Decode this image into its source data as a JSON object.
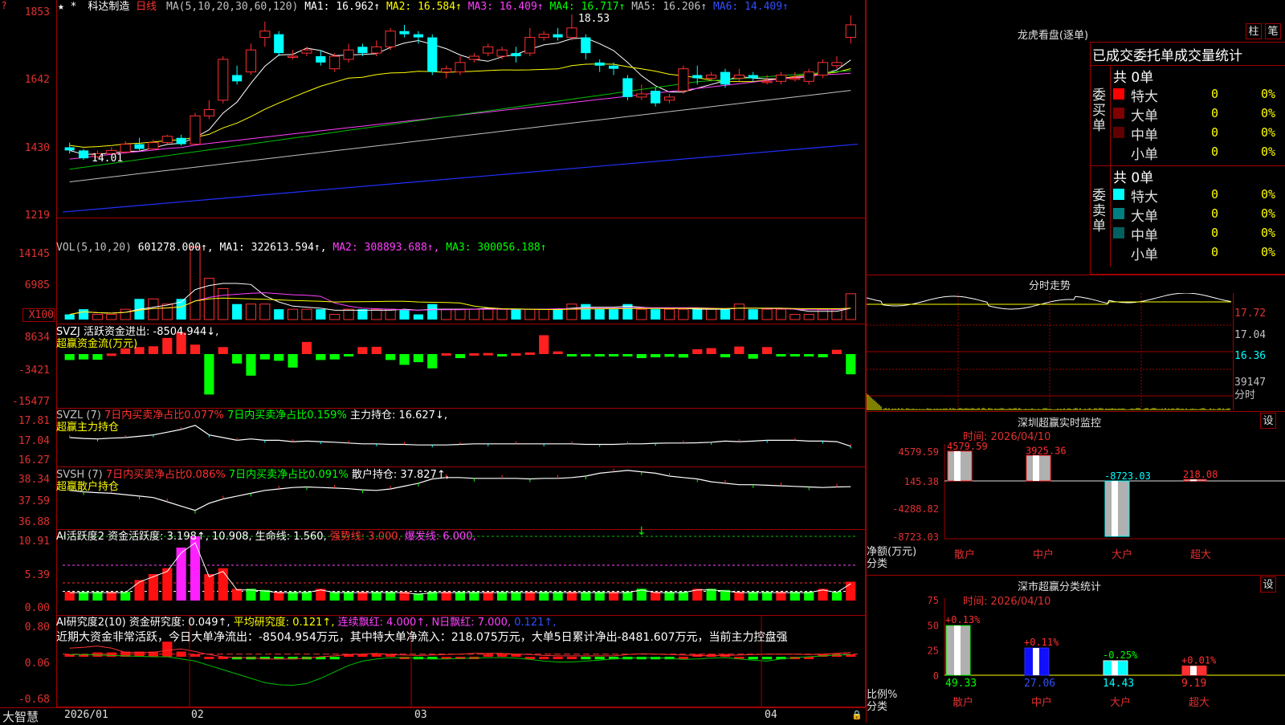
{
  "top_icon": "?",
  "stock": {
    "stars": "★ *",
    "name": "科达制造",
    "period": "日线",
    "ma_label": "MA(5,10,20,30,60,120)",
    "ma": [
      {
        "text": "MA1: 16.962↑",
        "color": "#ffffff"
      },
      {
        "text": "MA2: 16.584↑",
        "color": "#ffff00"
      },
      {
        "text": "MA3: 16.409↑",
        "color": "#ff40ff"
      },
      {
        "text": "MA4: 16.717↑",
        "color": "#00ff00"
      },
      {
        "text": "MA5: 16.206↑",
        "color": "#c0c0c0"
      },
      {
        "text": "MA6: 14.409↑",
        "color": "#3050ff"
      }
    ],
    "high_mark": "18.53",
    "low_mark": "14.01"
  },
  "axes": {
    "price": [
      "1853",
      "1642",
      "1430",
      "1219"
    ],
    "vol": [
      "14145",
      "6985",
      "X100"
    ],
    "svzj": [
      "8634",
      "-3421",
      "-15477"
    ],
    "svzl": [
      "17.81",
      "17.04",
      "16.27"
    ],
    "svsh": [
      "38.34",
      "37.59",
      "36.88"
    ],
    "ai1": [
      "10.91",
      "5.39",
      "0.00"
    ],
    "ai2": [
      "0.80",
      "0.06",
      "-0.68"
    ]
  },
  "vol_title": [
    {
      "text": "VOL(5,10,20)",
      "color": "#c0c0c0"
    },
    {
      "text": "601278.000↑,",
      "color": "#ffffff"
    },
    {
      "text": "MA1: 322613.594↑,",
      "color": "#ffffff"
    },
    {
      "text": "MA2: 308893.688↑,",
      "color": "#ff40ff"
    },
    {
      "text": "MA3: 300056.188↑",
      "color": "#00ff00"
    }
  ],
  "svzj_title": {
    "line1": "SVZJ  活跃资金进出: -8504.944↓,",
    "line2": "超赢资金流(万元)"
  },
  "svzl_title": {
    "prefix": "SVZL (7)",
    "a": "7日内买卖净占比0.077%",
    "b": "7日内买卖净占比0.159%",
    "c": "主力持仓: 16.627↓,",
    "line2": "超赢主力持仓"
  },
  "svsh_title": {
    "prefix": "SVSH (7)",
    "a": "7日内买卖净占比0.086%",
    "b": "7日内买卖净占比0.091%",
    "c": "散户持仓: 37.827↑,",
    "line2": "超赢散户持仓"
  },
  "ai1_title": [
    {
      "text": "AI活跃度2 资金活跃度: 3.198↑,",
      "color": "#ffffff"
    },
    {
      "text": "10.908,",
      "color": "#ffffff"
    },
    {
      "text": "生命线: 1.560,",
      "color": "#ffffff"
    },
    {
      "text": "强势线: 3.000,",
      "color": "#ff3030"
    },
    {
      "text": "爆发线: 6.000,",
      "color": "#ff40ff"
    }
  ],
  "ai2_title": [
    {
      "text": "AI研究度2(10) 资金研究度: 0.049↑,",
      "color": "#ffffff"
    },
    {
      "text": "平均研究度: 0.121↑,",
      "color": "#ffff00"
    },
    {
      "text": "连续飘红: 4.000↑,",
      "color": "#ff40ff"
    },
    {
      "text": "N日飘红: 7.000,",
      "color": "#ff40ff"
    },
    {
      "text": "0.121↑,",
      "color": "#3050ff"
    }
  ],
  "ai2_note": "近期大资金非常活跃，今日大单净流出：-8504.954万元，其中特大单净流入：218.075万元，大单5日累计净出-8481.607万元，当前主力控盘强",
  "bottom": {
    "brand": "大智慧",
    "dates": [
      "2026/01",
      "02",
      "03",
      "04"
    ]
  },
  "right": {
    "lhb_title": "龙虎看盘(逐单)",
    "btn_zhu": "柱",
    "btn_bi": "笔",
    "lhb_header": "已成交委托单成交量统计",
    "buy": {
      "side": "委买单",
      "total": "共 0单",
      "rows": [
        {
          "name": "特大",
          "v": "0",
          "p": "0%",
          "c": "#ff0000"
        },
        {
          "name": "大单",
          "v": "0",
          "p": "0%",
          "c": "#800000"
        },
        {
          "name": "中单",
          "v": "0",
          "p": "0%",
          "c": "#600000"
        },
        {
          "name": "小单",
          "v": "0",
          "p": "0%",
          "c": "#000000"
        }
      ]
    },
    "sell": {
      "side": "委卖单",
      "total": "共 0单",
      "rows": [
        {
          "name": "特大",
          "v": "0",
          "p": "0%",
          "c": "#00ffff"
        },
        {
          "name": "大单",
          "v": "0",
          "p": "0%",
          "c": "#008080"
        },
        {
          "name": "中单",
          "v": "0",
          "p": "0%",
          "c": "#006060"
        },
        {
          "name": "小单",
          "v": "0",
          "p": "0%",
          "c": "#000000"
        }
      ]
    },
    "fs_title": "分时走势",
    "fs_axis": [
      "17.72",
      "17.04",
      "16.36",
      "39147",
      "分时"
    ],
    "mon_title": "深圳超赢实时监控",
    "mon_set": "设",
    "mon_time": "时间: 2026/04/10",
    "mon_axis": [
      "4579.59",
      "145.38",
      "-4288.82",
      "-8723.03"
    ],
    "mon_ylabel": [
      "净额(万元)",
      "分类"
    ],
    "mon_bars": [
      {
        "cat": "散户",
        "value": 4579.59,
        "label": "4579.59"
      },
      {
        "cat": "中户",
        "value": 3925.36,
        "label": "3925.36"
      },
      {
        "cat": "大户",
        "value": -8723.03,
        "label": "-8723.03"
      },
      {
        "cat": "超大",
        "value": 218.08,
        "label": "218.08"
      }
    ],
    "cls_title": "深市超赢分类统计",
    "cls_set": "设",
    "cls_time": "时间: 2026/04/10",
    "cls_axis": [
      "75",
      "50",
      "25",
      "0"
    ],
    "cls_ylabel": [
      "比例%",
      "分类"
    ],
    "cls_bars": [
      {
        "cat": "散户",
        "value": 49.33,
        "label": "49.33",
        "delta": "+0.13%"
      },
      {
        "cat": "中户",
        "value": 27.06,
        "label": "27.06",
        "delta": "+0.11%"
      },
      {
        "cat": "大户",
        "value": 14.43,
        "label": "14.43",
        "delta": "-0.25%"
      },
      {
        "cat": "超大",
        "value": 9.19,
        "label": "9.19",
        "delta": "+0.01%"
      }
    ]
  },
  "chart_data": [
    {
      "type": "candlestick",
      "title": "科达制造 日线",
      "ylim": [
        12.19,
        18.53
      ],
      "ohlc": [
        [
          14.3,
          14.2,
          14.45,
          14.1
        ],
        [
          14.2,
          13.95,
          14.25,
          13.9
        ],
        [
          14.0,
          14.1,
          14.2,
          13.95
        ],
        [
          14.1,
          14.2,
          14.3,
          14.05
        ],
        [
          14.15,
          14.4,
          14.5,
          14.1
        ],
        [
          14.4,
          14.25,
          14.6,
          14.2
        ],
        [
          14.25,
          14.45,
          14.55,
          14.2
        ],
        [
          14.45,
          14.65,
          14.7,
          14.4
        ],
        [
          14.6,
          14.4,
          14.7,
          14.35
        ],
        [
          14.4,
          15.3,
          15.4,
          14.4
        ],
        [
          15.3,
          15.5,
          15.8,
          15.2
        ],
        [
          15.8,
          17.1,
          17.2,
          15.7
        ],
        [
          16.6,
          16.4,
          16.9,
          16.3
        ],
        [
          16.7,
          17.4,
          17.6,
          16.6
        ],
        [
          17.8,
          18.0,
          18.3,
          17.5
        ],
        [
          17.9,
          17.3,
          18.0,
          17.2
        ],
        [
          17.2,
          17.2,
          17.4,
          17.1
        ],
        [
          17.3,
          17.4,
          17.5,
          17.2
        ],
        [
          17.2,
          17.0,
          17.4,
          16.9
        ],
        [
          16.8,
          17.2,
          17.3,
          16.7
        ],
        [
          17.1,
          17.4,
          17.6,
          17.0
        ],
        [
          17.5,
          17.3,
          17.6,
          17.2
        ],
        [
          17.3,
          17.5,
          17.7,
          17.2
        ],
        [
          17.5,
          18.0,
          18.1,
          17.4
        ],
        [
          18.0,
          17.9,
          18.2,
          17.8
        ],
        [
          17.9,
          17.8,
          18.0,
          17.6
        ],
        [
          17.8,
          16.7,
          17.9,
          16.6
        ],
        [
          16.7,
          16.8,
          16.9,
          16.5
        ],
        [
          16.7,
          17.0,
          17.2,
          16.6
        ],
        [
          17.1,
          17.2,
          17.3,
          17.0
        ],
        [
          17.3,
          17.5,
          17.6,
          17.2
        ],
        [
          17.2,
          17.4,
          17.5,
          17.1
        ],
        [
          17.3,
          17.2,
          17.5,
          17.0
        ],
        [
          17.3,
          17.8,
          18.1,
          17.2
        ],
        [
          17.8,
          17.9,
          18.0,
          17.7
        ],
        [
          17.9,
          17.8,
          18.1,
          17.7
        ],
        [
          17.8,
          18.1,
          18.53,
          17.7
        ],
        [
          17.8,
          17.3,
          17.9,
          17.1
        ],
        [
          17.0,
          16.9,
          17.1,
          16.7
        ],
        [
          16.9,
          16.8,
          17.0,
          16.6
        ],
        [
          16.5,
          15.9,
          16.6,
          15.8
        ],
        [
          15.9,
          16.0,
          16.3,
          15.8
        ],
        [
          16.1,
          15.7,
          16.2,
          15.6
        ],
        [
          15.8,
          15.9,
          16.0,
          15.7
        ],
        [
          16.1,
          16.8,
          16.9,
          16.0
        ],
        [
          16.6,
          16.5,
          16.9,
          16.3
        ],
        [
          16.5,
          16.6,
          16.7,
          16.4
        ],
        [
          16.7,
          16.3,
          16.8,
          16.2
        ],
        [
          16.5,
          16.6,
          16.8,
          16.4
        ],
        [
          16.6,
          16.5,
          16.7,
          16.4
        ],
        [
          16.4,
          16.4,
          16.6,
          16.3
        ],
        [
          16.4,
          16.6,
          16.7,
          16.3
        ],
        [
          16.5,
          16.5,
          16.7,
          16.4
        ],
        [
          16.4,
          16.7,
          16.8,
          16.3
        ],
        [
          16.6,
          17.0,
          17.1,
          16.5
        ],
        [
          16.9,
          17.0,
          17.2,
          16.8
        ],
        [
          17.8,
          18.2,
          18.5,
          17.6
        ]
      ]
    },
    {
      "type": "bar",
      "title": "VOL(5,10,20)",
      "values": [
        1,
        2,
        1,
        1,
        2,
        4,
        4,
        3,
        4,
        14,
        8,
        6,
        3,
        3,
        3,
        2,
        2,
        2,
        2,
        1,
        2,
        2,
        2,
        2,
        2,
        1,
        3,
        2,
        2,
        2,
        2,
        2,
        2,
        2,
        2,
        2,
        3,
        3,
        2,
        2,
        3,
        2,
        2,
        2,
        2,
        2,
        2,
        2,
        3,
        2,
        2,
        2,
        1,
        1,
        2,
        2,
        5
      ]
    },
    {
      "type": "bar",
      "title": "超赢资金流(万元)",
      "values": [
        -2200,
        -2000,
        -2100,
        200,
        2100,
        2600,
        2900,
        6000,
        8000,
        3500,
        -15000,
        2600,
        -3500,
        -8000,
        -2000,
        -2500,
        -5000,
        4500,
        -2200,
        -2000,
        -600,
        2600,
        2700,
        -2200,
        -4000,
        -3000,
        -5300,
        300,
        -1500,
        300,
        400,
        -300,
        300,
        600,
        7000,
        1000,
        -300,
        -300,
        -300,
        -300,
        -300,
        -1500,
        -1200,
        -1000,
        -1300,
        1800,
        2200,
        -1200,
        2800,
        -1700,
        2600,
        -600,
        -600,
        -600,
        -1200,
        1600,
        -7500
      ]
    },
    {
      "type": "bar",
      "title": "AI活跃度2",
      "values": [
        1.5,
        1.5,
        1.5,
        1.5,
        1.5,
        3.5,
        4.5,
        5.5,
        9,
        10.9,
        4.5,
        5.5,
        2,
        2,
        1.8,
        1.5,
        1.5,
        1.5,
        2,
        1.5,
        1.5,
        1.5,
        1.5,
        1.5,
        1.5,
        1.2,
        1.5,
        1.5,
        1.5,
        1.5,
        1.5,
        1.5,
        1.5,
        1.5,
        1.5,
        1.5,
        1.5,
        1.5,
        1.5,
        1.5,
        1.5,
        2,
        1.5,
        1.5,
        1.5,
        2,
        2,
        1.8,
        1.5,
        1.5,
        1.5,
        1.5,
        1.5,
        1.5,
        2,
        1.5,
        3.2
      ]
    },
    {
      "type": "bar",
      "title": "AI研究度2(10)",
      "values": [
        0.06,
        0.06,
        0.1,
        0.1,
        0.12,
        0.12,
        0.12,
        0.35,
        0.12,
        0.06,
        0,
        0,
        -0.06,
        -0.06,
        -0.06,
        -0.06,
        -0.06,
        -0.06,
        -0.06,
        -0.06,
        0.06,
        0.06,
        0.06,
        0.06,
        0,
        -0.06,
        -0.06,
        0,
        0,
        0,
        0.06,
        0.06,
        0.06,
        0,
        0,
        0,
        0,
        -0.06,
        -0.06,
        -0.06,
        -0.06,
        -0.06,
        -0.06,
        -0.06,
        0,
        0.06,
        0.06,
        0.06,
        0,
        -0.06,
        -0.06,
        -0.06,
        0,
        0,
        0.06,
        0.06,
        0.06
      ]
    }
  ]
}
